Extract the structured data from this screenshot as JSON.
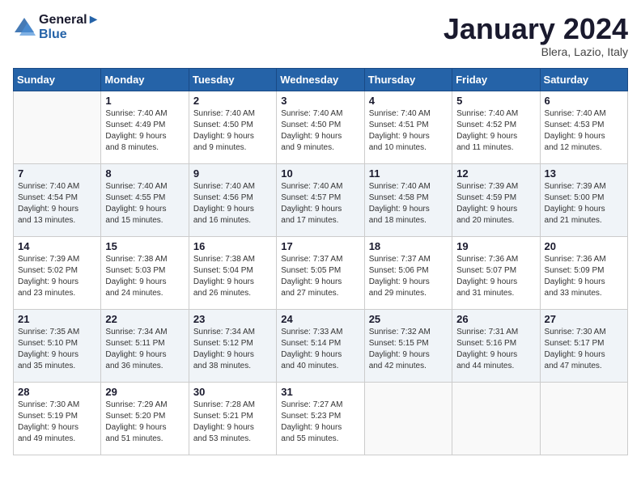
{
  "header": {
    "logo_line1": "General",
    "logo_line2": "Blue",
    "title": "January 2024",
    "subtitle": "Blera, Lazio, Italy"
  },
  "weekdays": [
    "Sunday",
    "Monday",
    "Tuesday",
    "Wednesday",
    "Thursday",
    "Friday",
    "Saturday"
  ],
  "weeks": [
    [
      {
        "day": "",
        "info": ""
      },
      {
        "day": "1",
        "info": "Sunrise: 7:40 AM\nSunset: 4:49 PM\nDaylight: 9 hours\nand 8 minutes."
      },
      {
        "day": "2",
        "info": "Sunrise: 7:40 AM\nSunset: 4:50 PM\nDaylight: 9 hours\nand 9 minutes."
      },
      {
        "day": "3",
        "info": "Sunrise: 7:40 AM\nSunset: 4:50 PM\nDaylight: 9 hours\nand 9 minutes."
      },
      {
        "day": "4",
        "info": "Sunrise: 7:40 AM\nSunset: 4:51 PM\nDaylight: 9 hours\nand 10 minutes."
      },
      {
        "day": "5",
        "info": "Sunrise: 7:40 AM\nSunset: 4:52 PM\nDaylight: 9 hours\nand 11 minutes."
      },
      {
        "day": "6",
        "info": "Sunrise: 7:40 AM\nSunset: 4:53 PM\nDaylight: 9 hours\nand 12 minutes."
      }
    ],
    [
      {
        "day": "7",
        "info": "Sunrise: 7:40 AM\nSunset: 4:54 PM\nDaylight: 9 hours\nand 13 minutes."
      },
      {
        "day": "8",
        "info": "Sunrise: 7:40 AM\nSunset: 4:55 PM\nDaylight: 9 hours\nand 15 minutes."
      },
      {
        "day": "9",
        "info": "Sunrise: 7:40 AM\nSunset: 4:56 PM\nDaylight: 9 hours\nand 16 minutes."
      },
      {
        "day": "10",
        "info": "Sunrise: 7:40 AM\nSunset: 4:57 PM\nDaylight: 9 hours\nand 17 minutes."
      },
      {
        "day": "11",
        "info": "Sunrise: 7:40 AM\nSunset: 4:58 PM\nDaylight: 9 hours\nand 18 minutes."
      },
      {
        "day": "12",
        "info": "Sunrise: 7:39 AM\nSunset: 4:59 PM\nDaylight: 9 hours\nand 20 minutes."
      },
      {
        "day": "13",
        "info": "Sunrise: 7:39 AM\nSunset: 5:00 PM\nDaylight: 9 hours\nand 21 minutes."
      }
    ],
    [
      {
        "day": "14",
        "info": "Sunrise: 7:39 AM\nSunset: 5:02 PM\nDaylight: 9 hours\nand 23 minutes."
      },
      {
        "day": "15",
        "info": "Sunrise: 7:38 AM\nSunset: 5:03 PM\nDaylight: 9 hours\nand 24 minutes."
      },
      {
        "day": "16",
        "info": "Sunrise: 7:38 AM\nSunset: 5:04 PM\nDaylight: 9 hours\nand 26 minutes."
      },
      {
        "day": "17",
        "info": "Sunrise: 7:37 AM\nSunset: 5:05 PM\nDaylight: 9 hours\nand 27 minutes."
      },
      {
        "day": "18",
        "info": "Sunrise: 7:37 AM\nSunset: 5:06 PM\nDaylight: 9 hours\nand 29 minutes."
      },
      {
        "day": "19",
        "info": "Sunrise: 7:36 AM\nSunset: 5:07 PM\nDaylight: 9 hours\nand 31 minutes."
      },
      {
        "day": "20",
        "info": "Sunrise: 7:36 AM\nSunset: 5:09 PM\nDaylight: 9 hours\nand 33 minutes."
      }
    ],
    [
      {
        "day": "21",
        "info": "Sunrise: 7:35 AM\nSunset: 5:10 PM\nDaylight: 9 hours\nand 35 minutes."
      },
      {
        "day": "22",
        "info": "Sunrise: 7:34 AM\nSunset: 5:11 PM\nDaylight: 9 hours\nand 36 minutes."
      },
      {
        "day": "23",
        "info": "Sunrise: 7:34 AM\nSunset: 5:12 PM\nDaylight: 9 hours\nand 38 minutes."
      },
      {
        "day": "24",
        "info": "Sunrise: 7:33 AM\nSunset: 5:14 PM\nDaylight: 9 hours\nand 40 minutes."
      },
      {
        "day": "25",
        "info": "Sunrise: 7:32 AM\nSunset: 5:15 PM\nDaylight: 9 hours\nand 42 minutes."
      },
      {
        "day": "26",
        "info": "Sunrise: 7:31 AM\nSunset: 5:16 PM\nDaylight: 9 hours\nand 44 minutes."
      },
      {
        "day": "27",
        "info": "Sunrise: 7:30 AM\nSunset: 5:17 PM\nDaylight: 9 hours\nand 47 minutes."
      }
    ],
    [
      {
        "day": "28",
        "info": "Sunrise: 7:30 AM\nSunset: 5:19 PM\nDaylight: 9 hours\nand 49 minutes."
      },
      {
        "day": "29",
        "info": "Sunrise: 7:29 AM\nSunset: 5:20 PM\nDaylight: 9 hours\nand 51 minutes."
      },
      {
        "day": "30",
        "info": "Sunrise: 7:28 AM\nSunset: 5:21 PM\nDaylight: 9 hours\nand 53 minutes."
      },
      {
        "day": "31",
        "info": "Sunrise: 7:27 AM\nSunset: 5:23 PM\nDaylight: 9 hours\nand 55 minutes."
      },
      {
        "day": "",
        "info": ""
      },
      {
        "day": "",
        "info": ""
      },
      {
        "day": "",
        "info": ""
      }
    ]
  ]
}
